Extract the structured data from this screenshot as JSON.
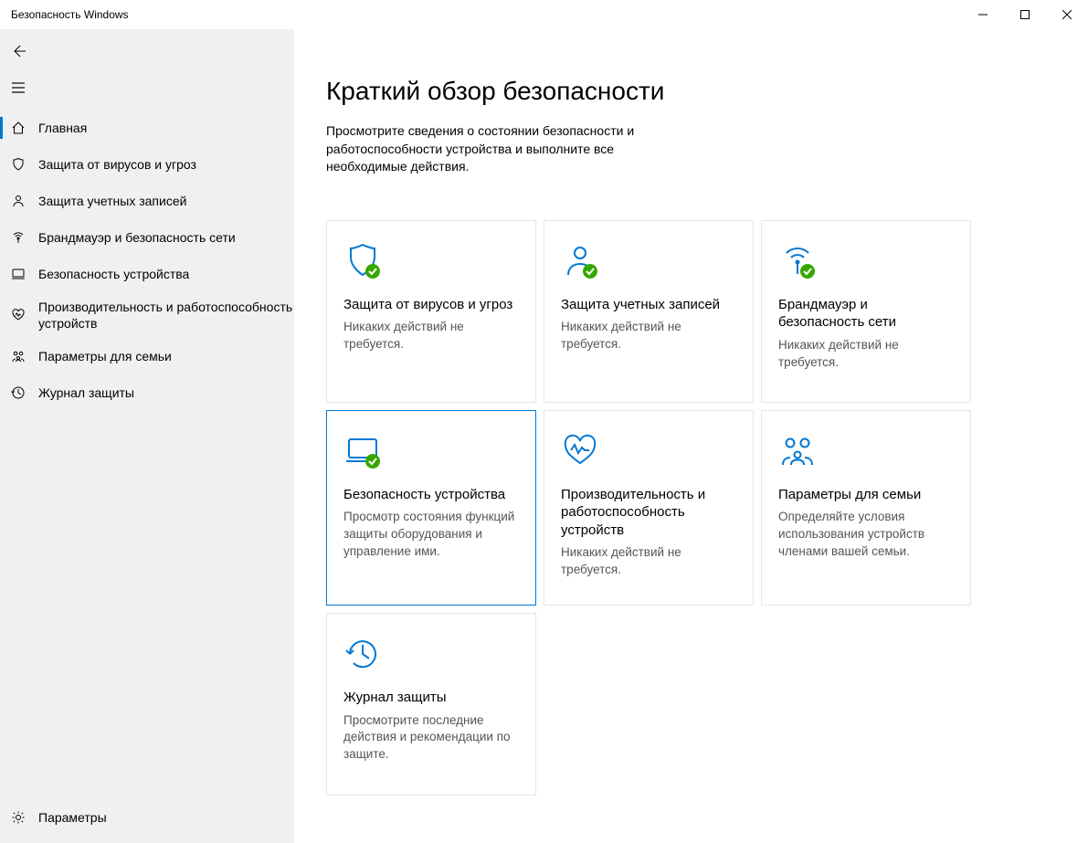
{
  "window": {
    "title": "Безопасность Windows"
  },
  "sidebar": {
    "items": [
      {
        "label": "Главная",
        "icon": "home-icon",
        "active": true
      },
      {
        "label": "Защита от вирусов и угроз",
        "icon": "shield-icon"
      },
      {
        "label": "Защита учетных записей",
        "icon": "person-icon"
      },
      {
        "label": "Брандмауэр и безопасность сети",
        "icon": "network-icon"
      },
      {
        "label": "Безопасность устройства",
        "icon": "device-icon"
      },
      {
        "label": "Производительность и работоспособность устройств",
        "icon": "heart-icon",
        "multiline": true
      },
      {
        "label": "Параметры для семьи",
        "icon": "family-icon"
      },
      {
        "label": "Журнал защиты",
        "icon": "history-icon"
      }
    ],
    "settings_label": "Параметры"
  },
  "main": {
    "title": "Краткий обзор безопасности",
    "subtitle": "Просмотрите сведения о состоянии безопасности и работоспособности устройства и выполните все необходимые действия.",
    "tiles": [
      {
        "title": "Защита от вирусов и угроз",
        "desc": "Никаких действий не требуется.",
        "icon": "shield-icon",
        "check": true
      },
      {
        "title": "Защита учетных записей",
        "desc": "Никаких действий не требуется.",
        "icon": "person-icon",
        "check": true
      },
      {
        "title": "Брандмауэр и безопасность сети",
        "desc": "Никаких действий не требуется.",
        "icon": "network-icon",
        "check": true
      },
      {
        "title": "Безопасность устройства",
        "desc": "Просмотр состояния функций защиты оборудования и управление ими.",
        "icon": "device-icon",
        "check": true,
        "selected": true
      },
      {
        "title": "Производительность и работоспособность устройств",
        "desc": "Никаких действий не требуется.",
        "icon": "heart-icon",
        "check": false
      },
      {
        "title": "Параметры для семьи",
        "desc": "Определяйте условия использования устройств членами вашей семьи.",
        "icon": "family-icon",
        "check": false
      },
      {
        "title": "Журнал защиты",
        "desc": "Просмотрите последние действия и рекомендации по защите.",
        "icon": "history-icon",
        "check": false
      }
    ]
  }
}
